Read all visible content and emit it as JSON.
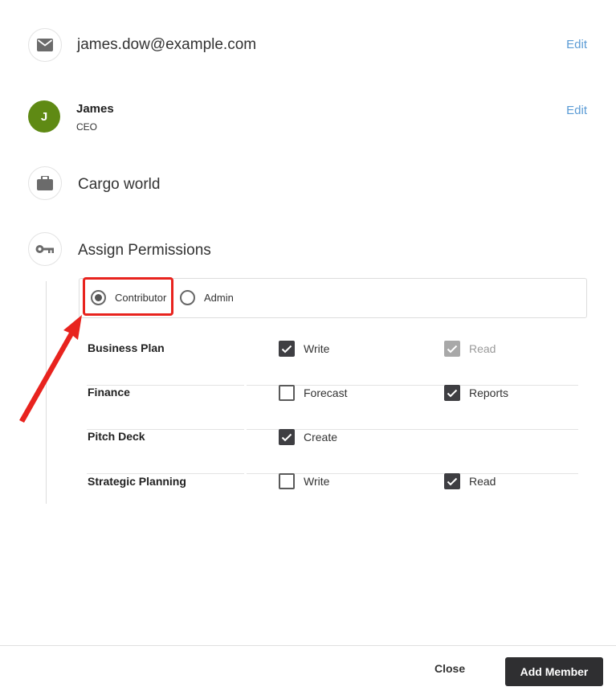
{
  "contact": {
    "email": "james.dow@example.com",
    "email_edit_label": "Edit",
    "avatar_initial": "J",
    "name": "James",
    "role": "CEO",
    "name_edit_label": "Edit",
    "company": "Cargo world"
  },
  "permissions": {
    "title": "Assign Permissions",
    "roles": [
      {
        "label": "Contributor",
        "selected": true
      },
      {
        "label": "Admin",
        "selected": false
      }
    ],
    "rows": [
      {
        "name": "Business Plan",
        "options": [
          {
            "label": "Write",
            "state": "checked"
          },
          {
            "label": "Read",
            "state": "checked-disabled"
          }
        ]
      },
      {
        "name": "Finance",
        "options": [
          {
            "label": "Forecast",
            "state": "unchecked"
          },
          {
            "label": "Reports",
            "state": "checked"
          }
        ]
      },
      {
        "name": "Pitch Deck",
        "options": [
          {
            "label": "Create",
            "state": "checked"
          }
        ]
      },
      {
        "name": "Strategic Planning",
        "options": [
          {
            "label": "Write",
            "state": "unchecked"
          },
          {
            "label": "Read",
            "state": "checked"
          }
        ]
      }
    ]
  },
  "footer": {
    "close_label": "Close",
    "add_label": "Add Member"
  },
  "icons": {
    "email": "mail-icon",
    "company": "briefcase-icon",
    "permissions": "key-icon"
  },
  "colors": {
    "accent_link": "#5b9bd5",
    "avatar_bg": "#5f8a14",
    "annotation_red": "#e8231e",
    "primary_button": "#2f2f31"
  }
}
